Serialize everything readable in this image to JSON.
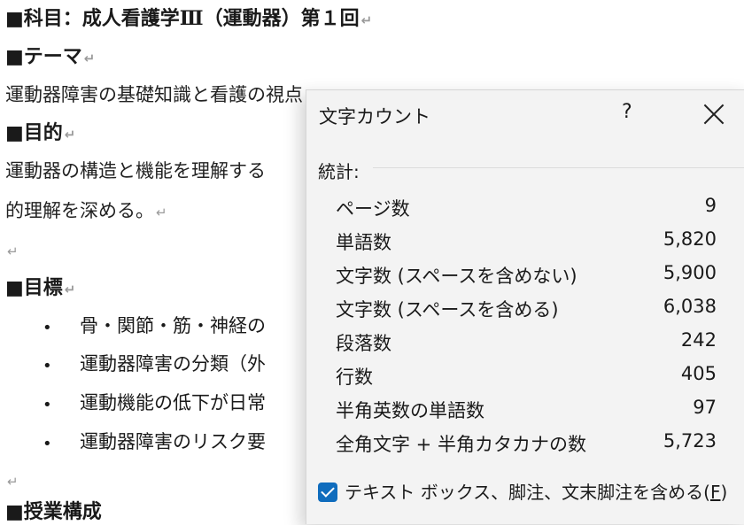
{
  "document": {
    "lines": [
      {
        "text": "■科目：成人看護学Ⅲ（運動器）第１回",
        "style": "heading",
        "mark": "↵"
      },
      {
        "text": "■テーマ",
        "style": "heading",
        "mark": "↵"
      },
      {
        "text": "運動器障害の基礎知識と看護の視点",
        "style": "para",
        "mark": ""
      },
      {
        "text": "■目的",
        "style": "heading",
        "mark": "↵"
      },
      {
        "text": "運動器の構造と機能を理解する",
        "style": "para",
        "mark": ""
      },
      {
        "text": "的理解を深める。",
        "style": "para",
        "mark": "↵"
      },
      {
        "text": "",
        "style": "para",
        "mark": "↵"
      },
      {
        "text": "■目標",
        "style": "heading",
        "mark": "↵"
      }
    ],
    "bullets": [
      "骨・関節・筋・神経の",
      "運動器障害の分類（外",
      "運動機能の低下が日常",
      "運動器障害のリスク要"
    ],
    "bullet_glyph": "•",
    "after_bullets_mark": "↵",
    "last_heading": "■授業構成"
  },
  "dialog": {
    "title": "文字カウント",
    "help_label": "?",
    "close_label": "Close",
    "stats_label": "統計:",
    "stats": [
      {
        "label": "ページ数",
        "value": "9"
      },
      {
        "label": "単語数",
        "value": "5,820"
      },
      {
        "label": "文字数 (スペースを含めない)",
        "value": "5,900"
      },
      {
        "label": "文字数 (スペースを含める)",
        "value": "6,038"
      },
      {
        "label": "段落数",
        "value": "242"
      },
      {
        "label": "行数",
        "value": "405"
      },
      {
        "label": "半角英数の単語数",
        "value": "97"
      },
      {
        "label": "全角文字 + 半角カタカナの数",
        "value": "5,723"
      }
    ],
    "checkbox": {
      "label": "テキスト ボックス、脚注、文末脚注を含める(",
      "accel": "F",
      "suffix": ")",
      "checked": true
    },
    "accent_color": "#0f6cbd"
  }
}
